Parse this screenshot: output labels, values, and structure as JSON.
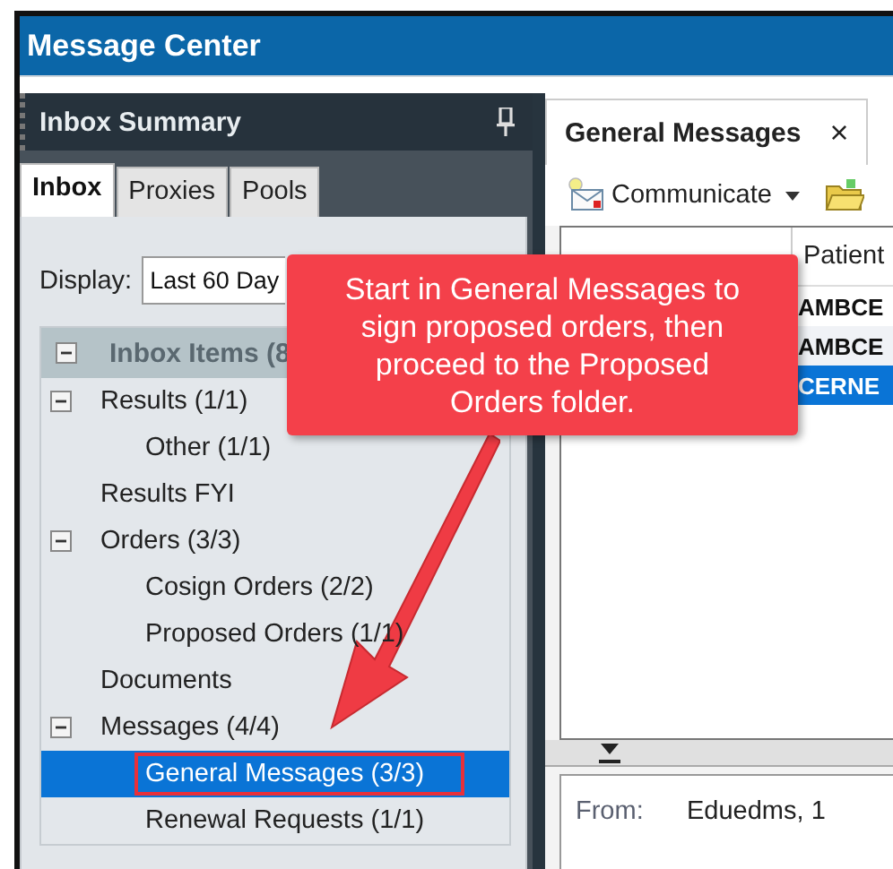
{
  "window": {
    "title": "Message Center"
  },
  "inbox_summary": {
    "title": "Inbox Summary",
    "tabs": [
      {
        "label": "Inbox",
        "selected": true
      },
      {
        "label": "Proxies",
        "selected": false
      },
      {
        "label": "Pools",
        "selected": false
      }
    ],
    "display": {
      "label": "Display:",
      "value": "Last 60 Day"
    },
    "tree": {
      "label": "Inbox Items (8",
      "expanded": true,
      "children": [
        {
          "label": "Results (1/1)",
          "expanded": true,
          "children": [
            {
              "label": "Other (1/1)",
              "selected": false,
              "outlined": false
            }
          ]
        },
        {
          "label": "Results FYI",
          "selected": false,
          "outlined": false
        },
        {
          "label": "Orders (3/3)",
          "expanded": true,
          "children": [
            {
              "label": "Cosign Orders (2/2)",
              "selected": false,
              "outlined": false
            },
            {
              "label": "Proposed Orders (1/1)",
              "selected": false,
              "outlined": false
            }
          ]
        },
        {
          "label": "Documents",
          "selected": false,
          "outlined": false
        },
        {
          "label": "Messages (4/4)",
          "expanded": true,
          "children": [
            {
              "label": "General Messages (3/3)",
              "selected": true,
              "outlined": true
            },
            {
              "label": "Renewal Requests (1/1)",
              "selected": false,
              "outlined": false
            }
          ]
        }
      ]
    }
  },
  "message_pane": {
    "tabs": [
      {
        "label": "General Messages",
        "selected": true,
        "close": "×"
      }
    ],
    "toolbar": {
      "communicate": "Communicate"
    },
    "table": {
      "columns": [
        "Patient"
      ],
      "rows": [
        {
          "patient": "AMBCE",
          "selected": false
        },
        {
          "patient": "AMBCE",
          "selected": false
        },
        {
          "patient": "CERNE",
          "selected": true
        }
      ]
    },
    "details": [
      {
        "label": "From:",
        "value": "Eduedms, 1"
      }
    ]
  },
  "callout": {
    "text": "Start in General Messages to sign proposed orders, then proceed to the Proposed Orders folder."
  }
}
